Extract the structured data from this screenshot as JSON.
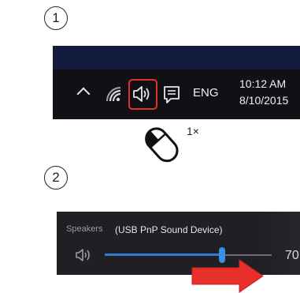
{
  "steps": {
    "step1": "1",
    "step2": "2"
  },
  "taskbar": {
    "language": "ENG",
    "time": "10:12 AM",
    "date": "8/10/2015",
    "icons": [
      "chevron-up-icon",
      "wifi-icon",
      "speaker-icon",
      "action-center-icon"
    ],
    "highlighted_icon": "speaker-icon",
    "highlight_color": "#e8302b"
  },
  "mouse": {
    "click_count": "1×"
  },
  "volume_flyout": {
    "speakers_label": "Speakers",
    "device_name": "(USB PnP Sound Device)",
    "volume_value": "70",
    "volume_level": 70,
    "accent_color": "#2e7bd2"
  },
  "arrow_color": "#e8302b"
}
